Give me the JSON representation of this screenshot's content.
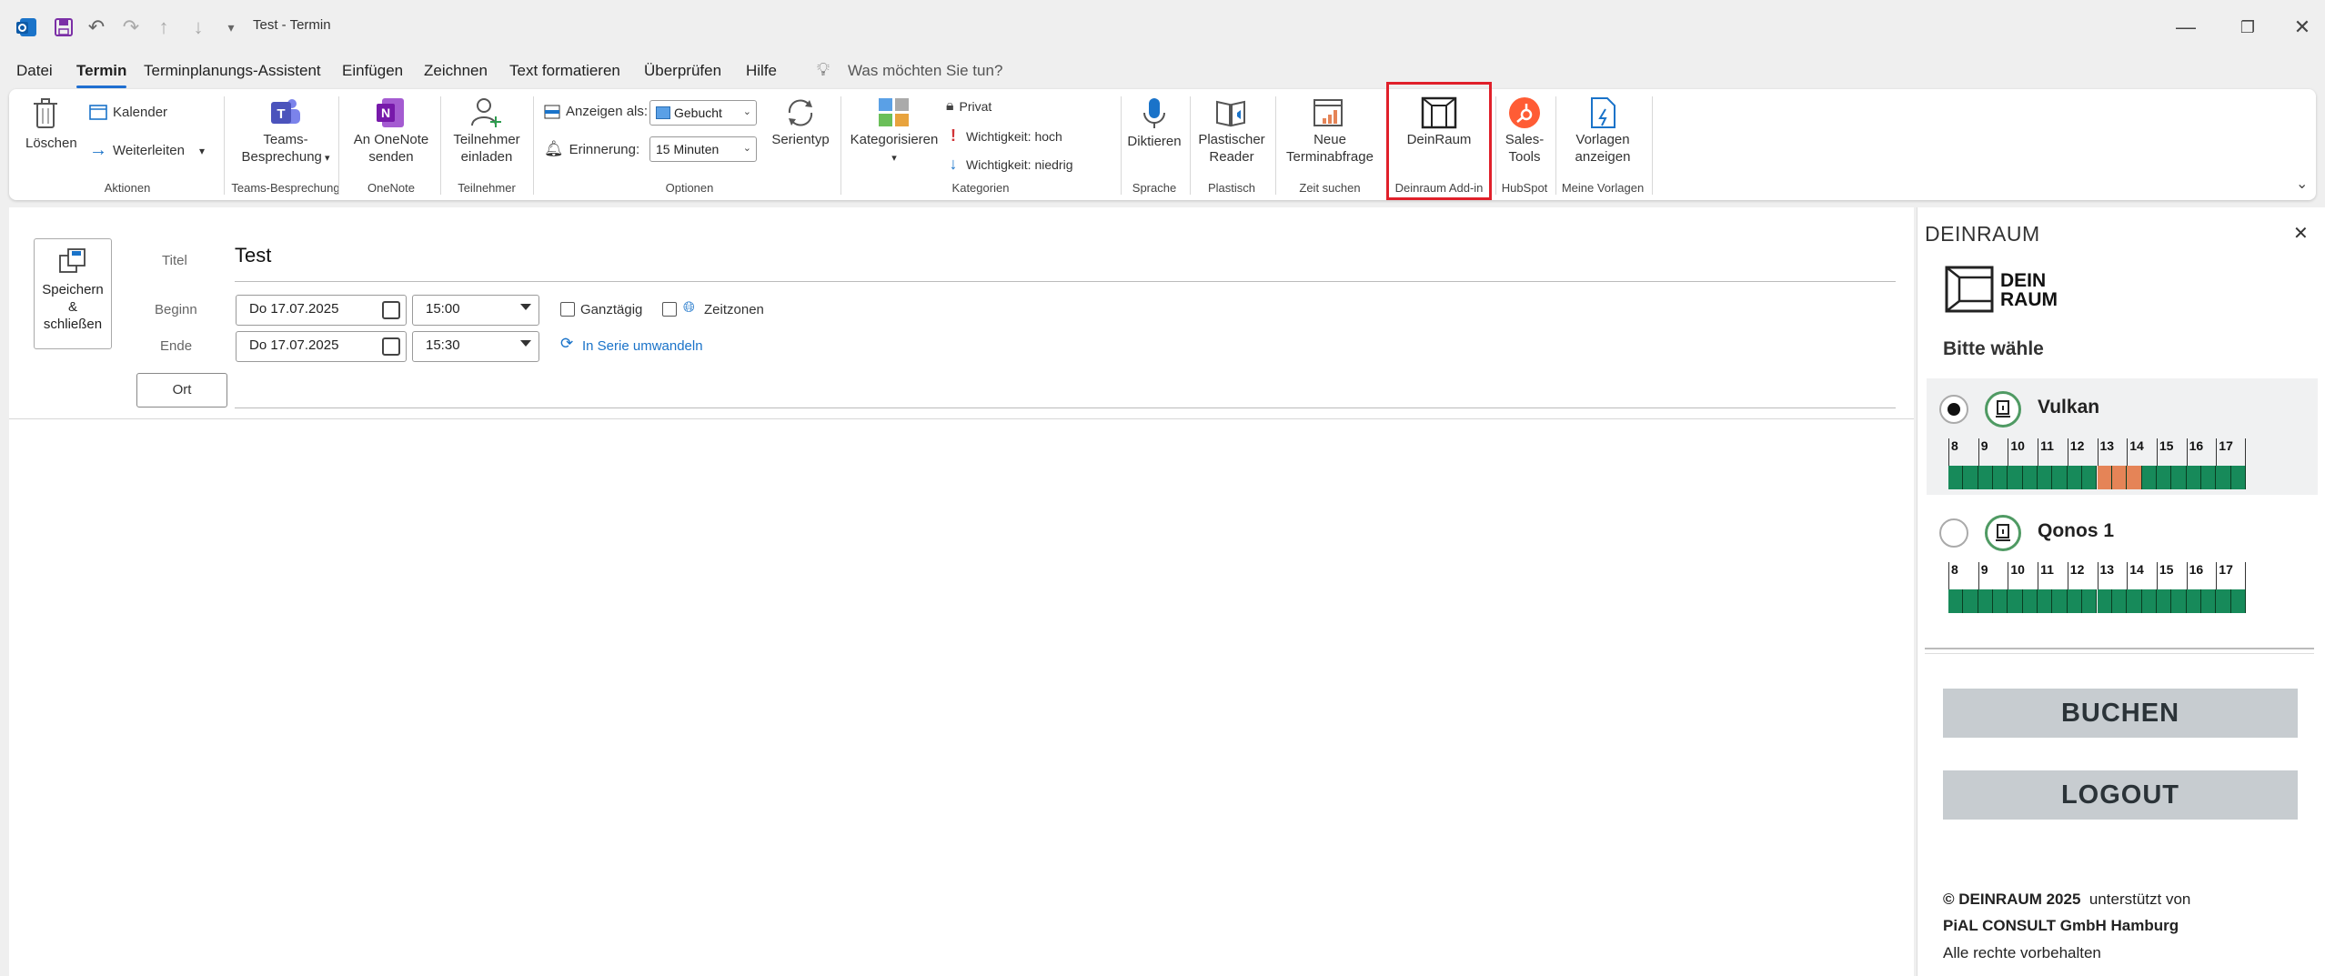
{
  "window": {
    "title": "Test  -  Termin",
    "controls": [
      "minimize-icon",
      "restore-icon",
      "close-icon"
    ]
  },
  "menu": {
    "items": [
      "Datei",
      "Termin",
      "Terminplanungs-Assistent",
      "Einfügen",
      "Zeichnen",
      "Text formatieren",
      "Überprüfen",
      "Hilfe"
    ],
    "active": "Termin",
    "search_text": "Was möchten Sie tun?"
  },
  "ribbon": {
    "aktionen": {
      "loeschen": "Löschen",
      "kalender": "Kalender",
      "weiterleiten": "Weiterleiten",
      "group": "Aktionen"
    },
    "teams": {
      "button_line1": "Teams-",
      "button_line2": "Besprechung",
      "group": "Teams-Besprechung"
    },
    "onenote": {
      "line1": "An OneNote",
      "line2": "senden",
      "group": "OneNote"
    },
    "teilnehmer": {
      "line1": "Teilnehmer",
      "line2": "einladen",
      "group": "Teilnehmer"
    },
    "optionen": {
      "anzeigen_label": "Anzeigen als:",
      "anzeigen_value": "Gebucht",
      "erinnerung_label": "Erinnerung:",
      "erinnerung_value": "15 Minuten",
      "serientyp": "Serientyp",
      "group": "Optionen"
    },
    "kategorien": {
      "kategorisieren": "Kategorisieren",
      "privat": "Privat",
      "hoch": "Wichtigkeit: hoch",
      "niedrig": "Wichtigkeit: niedrig",
      "group": "Kategorien"
    },
    "sprache": {
      "diktieren": "Diktieren",
      "group": "Sprache"
    },
    "plastisch": {
      "line1": "Plastischer",
      "line2": "Reader",
      "group": "Plastisch"
    },
    "zeit": {
      "line1": "Neue",
      "line2": "Terminabfrage",
      "group": "Zeit suchen"
    },
    "deinraum": {
      "button": "DeinRaum",
      "group": "Deinraum Add-in",
      "highlight_color": "#e0202a"
    },
    "hubspot": {
      "line1": "Sales-",
      "line2": "Tools",
      "group": "HubSpot"
    },
    "vorlagen": {
      "line1": "Vorlagen",
      "line2": "anzeigen",
      "group": "Meine Vorlagen"
    }
  },
  "form": {
    "save_line1": "Speichern",
    "save_line2": "&",
    "save_line3": "schließen",
    "titel_label": "Titel",
    "titel_value": "Test",
    "beginn_label": "Beginn",
    "beginn_date": "Do 17.07.2025",
    "beginn_time": "15:00",
    "ende_label": "Ende",
    "ende_date": "Do 17.07.2025",
    "ende_time": "15:30",
    "ganztaegig": "Ganztägig",
    "zeitzonen": "Zeitzonen",
    "serie": "In Serie umwandeln",
    "ort": "Ort"
  },
  "panel": {
    "header": "DEINRAUM",
    "logo_line1": "DEIN",
    "logo_line2": "RAUM",
    "prompt": "Bitte wähle",
    "hours": [
      "8",
      "9",
      "10",
      "11",
      "12",
      "13",
      "14",
      "15",
      "16",
      "17"
    ],
    "colors": {
      "free": "#178a5a",
      "busy": "#e58457",
      "accent": "#4f9a63"
    },
    "rooms": [
      {
        "name": "Vulkan",
        "selected": true,
        "slots": [
          "free",
          "free",
          "free",
          "free",
          "free",
          "free",
          "free",
          "free",
          "free",
          "free",
          "busy",
          "busy",
          "busy",
          "free",
          "free",
          "free",
          "free",
          "free",
          "free",
          "free"
        ]
      },
      {
        "name": "Qonos 1",
        "selected": false,
        "slots": [
          "free",
          "free",
          "free",
          "free",
          "free",
          "free",
          "free",
          "free",
          "free",
          "free",
          "free",
          "free",
          "free",
          "free",
          "free",
          "free",
          "free",
          "free",
          "free",
          "free"
        ]
      }
    ],
    "buchen": "BUCHEN",
    "logout": "LOGOUT",
    "footer_brand": "© DEINRAUM 2025",
    "footer_text": "  unterstützt von",
    "footer_line2": "PiAL CONSULT GmbH Hamburg",
    "footer_line3": "Alle rechte vorbehalten"
  }
}
